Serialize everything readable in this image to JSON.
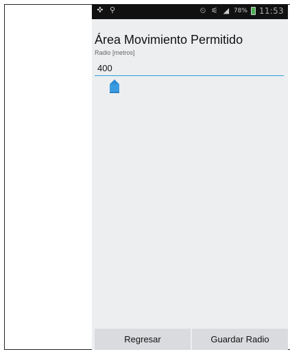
{
  "status_bar": {
    "time": "11:53",
    "battery_percent": "78%",
    "icons": [
      "gps-icon",
      "location-pin-icon",
      "alarm-icon",
      "wifi-icon",
      "signal-icon",
      "battery-icon"
    ]
  },
  "screen": {
    "title": "Área Movimiento Permitido",
    "subtitle": "Radio [metros]",
    "radius_value": "400",
    "slider_level": 0
  },
  "buttons": {
    "back": "Regresar",
    "save": "Guardar Radio"
  },
  "colors": {
    "accent": "#2c9fd8",
    "status_bar": "#111111",
    "background": "#eceef0"
  }
}
